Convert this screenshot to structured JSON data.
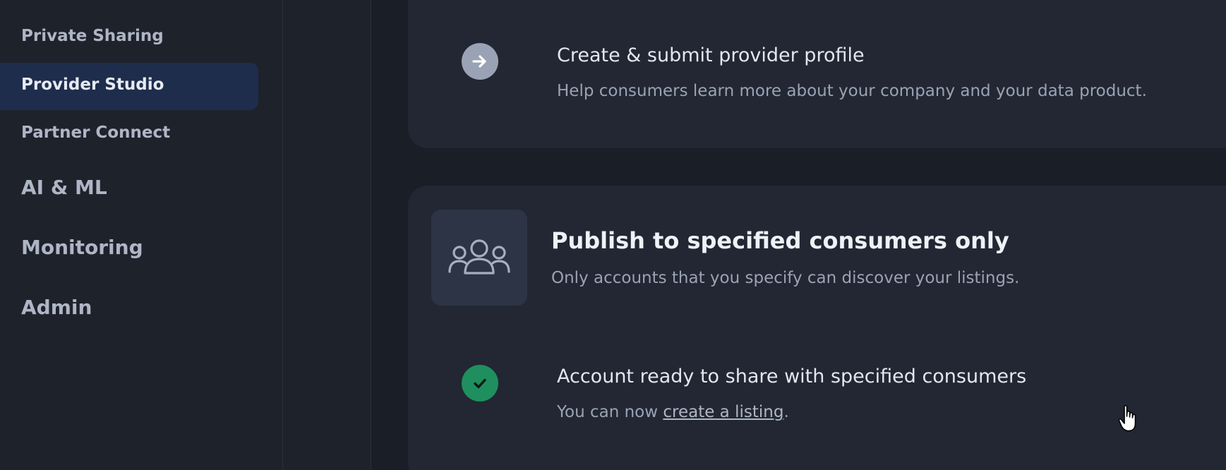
{
  "sidebar": {
    "items": [
      {
        "label": "Private Sharing",
        "active": false
      },
      {
        "label": "Provider Studio",
        "active": true
      },
      {
        "label": "Partner Connect",
        "active": false
      }
    ],
    "sections": [
      {
        "label": "AI & ML"
      },
      {
        "label": "Monitoring"
      },
      {
        "label": "Admin"
      }
    ]
  },
  "steps": {
    "profile": {
      "icon": "arrow-right-icon",
      "title": "Create & submit provider profile",
      "description": "Help consumers learn more about your company and your data product."
    }
  },
  "publish": {
    "icon": "users-group-icon",
    "title": "Publish to specified consumers only",
    "subtitle": "Only accounts that you specify can discover your listings.",
    "ready": {
      "icon": "check-icon",
      "title": "Account ready to share with specified consumers",
      "prefix": "You can now ",
      "link": "create a listing",
      "suffix": "."
    }
  },
  "colors": {
    "active_nav_bg": "#1f2d4d",
    "success": "#1f8f5f",
    "card_bg": "#222733"
  }
}
